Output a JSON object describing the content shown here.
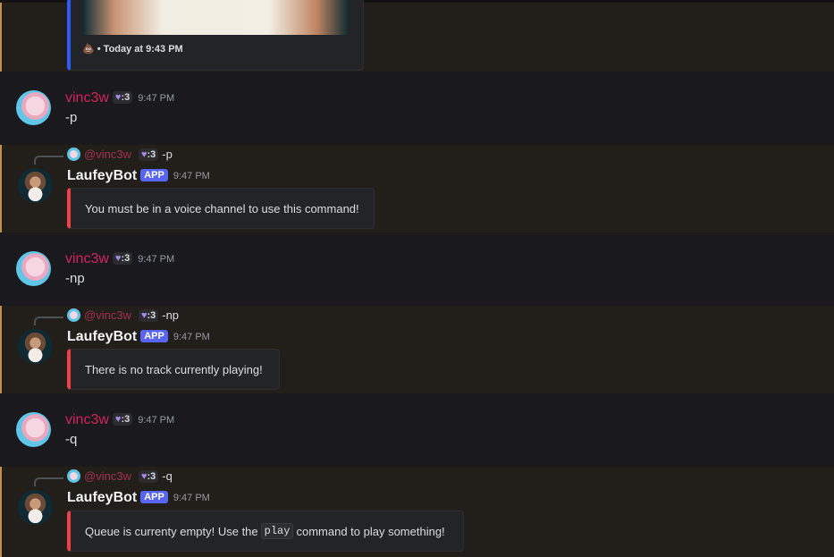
{
  "top_embed": {
    "footer_icon": "poop-emoji",
    "footer_text": "• Today at 9:43 PM"
  },
  "messages": [
    {
      "author": "vinc3w",
      "tag": ":3",
      "time": "9:47 PM",
      "content": "-p"
    },
    {
      "author": "LaufeyBot",
      "badge": "APP",
      "time": "9:47 PM",
      "reply_to": "@vinc3w",
      "reply_tag": ":3",
      "reply_text": "-p",
      "embed": "You must be in a voice channel to use this command!"
    },
    {
      "author": "vinc3w",
      "tag": ":3",
      "time": "9:47 PM",
      "content": "-np"
    },
    {
      "author": "LaufeyBot",
      "badge": "APP",
      "time": "9:47 PM",
      "reply_to": "@vinc3w",
      "reply_tag": ":3",
      "reply_text": "-np",
      "embed": "There is no track currently playing!"
    },
    {
      "author": "vinc3w",
      "tag": ":3",
      "time": "9:47 PM",
      "content": "-q"
    },
    {
      "author": "LaufeyBot",
      "badge": "APP",
      "time": "9:47 PM",
      "reply_to": "@vinc3w",
      "reply_tag": ":3",
      "reply_text": "-q",
      "embed_pre": "Queue is currenty empty! Use the",
      "embed_code": "play",
      "embed_post": "command to play something!"
    }
  ],
  "colors": {
    "user": "#d3245a",
    "app_badge": "#5865f2",
    "embed_error": "#f23f43",
    "mention_highlight": "#c3904a"
  }
}
